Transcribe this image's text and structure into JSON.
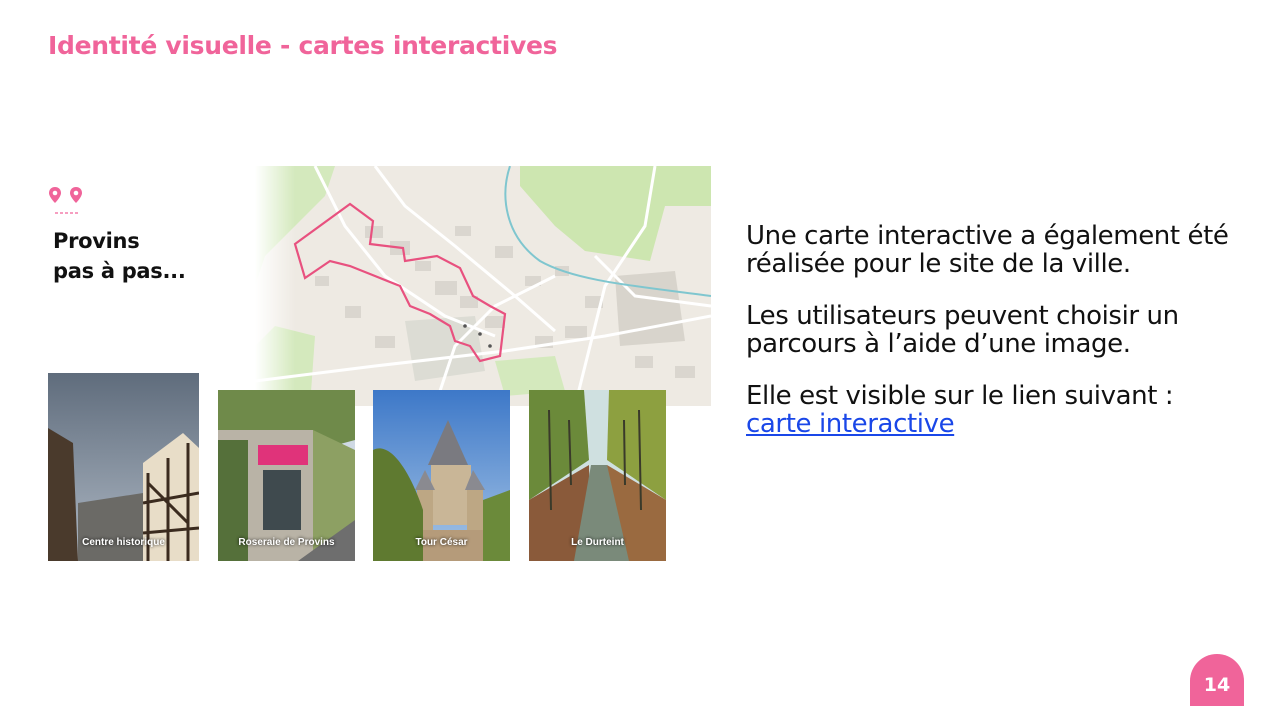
{
  "slide": {
    "title": "Identité visuelle - cartes interactives",
    "brand_line1": "Provins",
    "brand_line2": "pas à pas...",
    "page_number": "14"
  },
  "photos": [
    {
      "caption": "Centre historique"
    },
    {
      "caption": "Roseraie de Provins"
    },
    {
      "caption": "Tour César"
    },
    {
      "caption": "Le Durteint"
    }
  ],
  "text": {
    "p1": "Une carte interactive a également été réalisée pour le site de la ville.",
    "p2": "Les utilisateurs peuvent choisir un parcours à l’aide d’une image.",
    "p3": "Elle est visible sur le lien suivant :",
    "link": "carte interactive"
  },
  "colors": {
    "accent": "#f0649a",
    "link": "#1a47e8",
    "route": "#e8517f",
    "river": "#7fc6cf",
    "park": "#cde6b0"
  },
  "icons": [
    "map-pin-icon",
    "map-pin-icon"
  ]
}
